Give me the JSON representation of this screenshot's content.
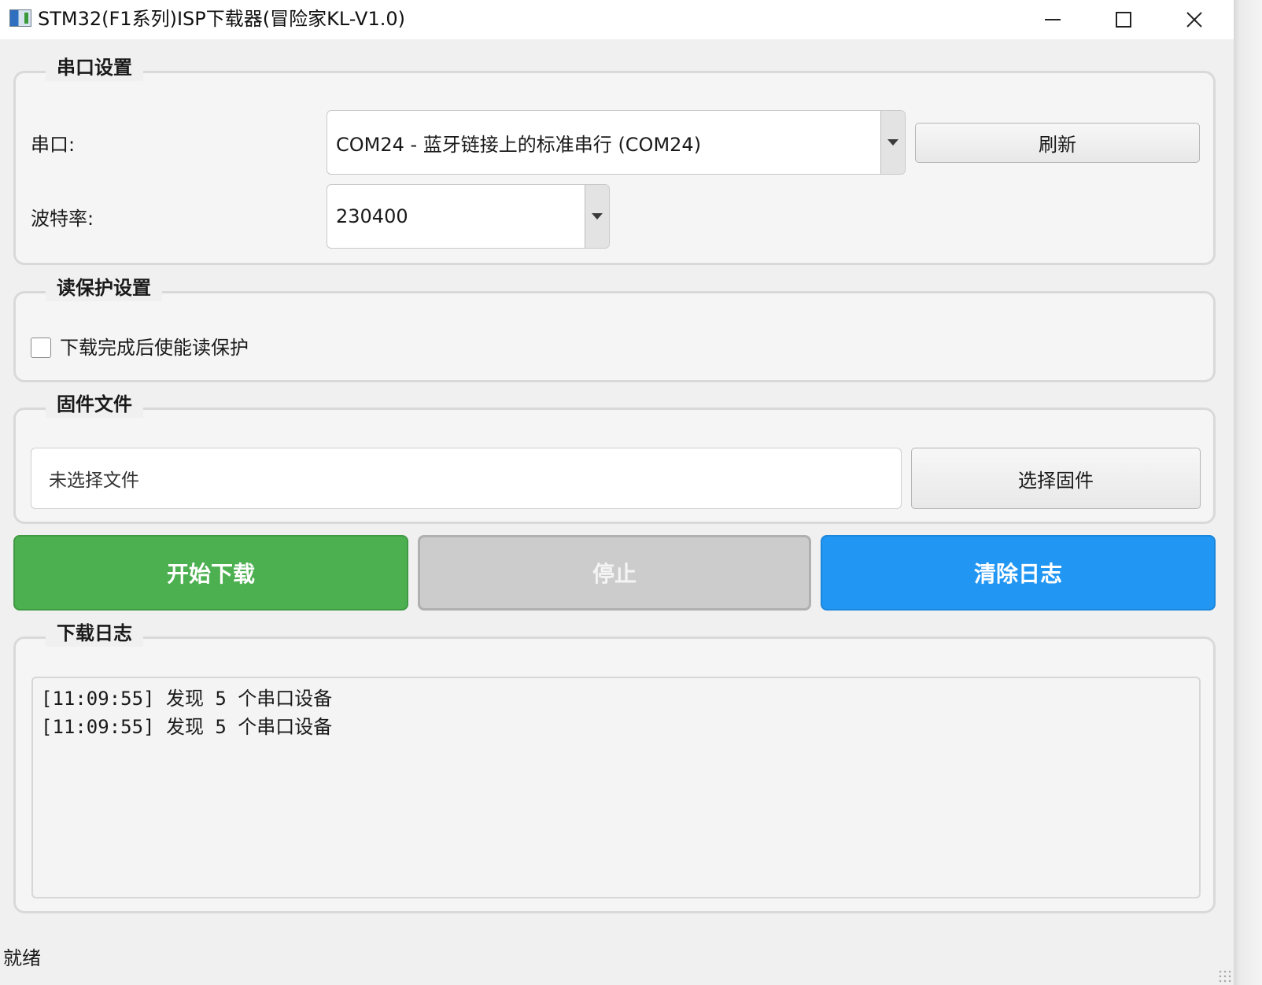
{
  "window": {
    "title": "STM32(F1系列)ISP下载器(冒险家KL-V1.0)",
    "controls": [
      "minimize",
      "maximize",
      "close"
    ]
  },
  "serial_group": {
    "title": "串口设置",
    "port_label": "串口:",
    "port_value": "COM24 - 蓝牙链接上的标准串行 (COM24)",
    "refresh_label": "刷新",
    "baud_label": "波特率:",
    "baud_value": "230400"
  },
  "protect_group": {
    "title": "读保护设置",
    "checkbox_label": "下载完成后使能读保护",
    "checked": false
  },
  "firmware_group": {
    "title": "固件文件",
    "file_value": "未选择文件",
    "select_label": "选择固件"
  },
  "actions": {
    "start_label": "开始下载",
    "stop_label": "停止",
    "stop_enabled": false,
    "clear_label": "清除日志",
    "start_color": "#4caf50",
    "stop_color": "#cccccc",
    "clear_color": "#2196f3"
  },
  "log_group": {
    "title": "下载日志",
    "lines": [
      "[11:09:55] 发现 5 个串口设备",
      "[11:09:55] 发现 5 个串口设备"
    ]
  },
  "status": {
    "text": "就绪"
  },
  "icons": {
    "app": "app-window-icon",
    "dropdown": "chevron-down-icon",
    "minimize": "minimize-icon",
    "maximize": "maximize-icon",
    "close": "close-icon"
  }
}
